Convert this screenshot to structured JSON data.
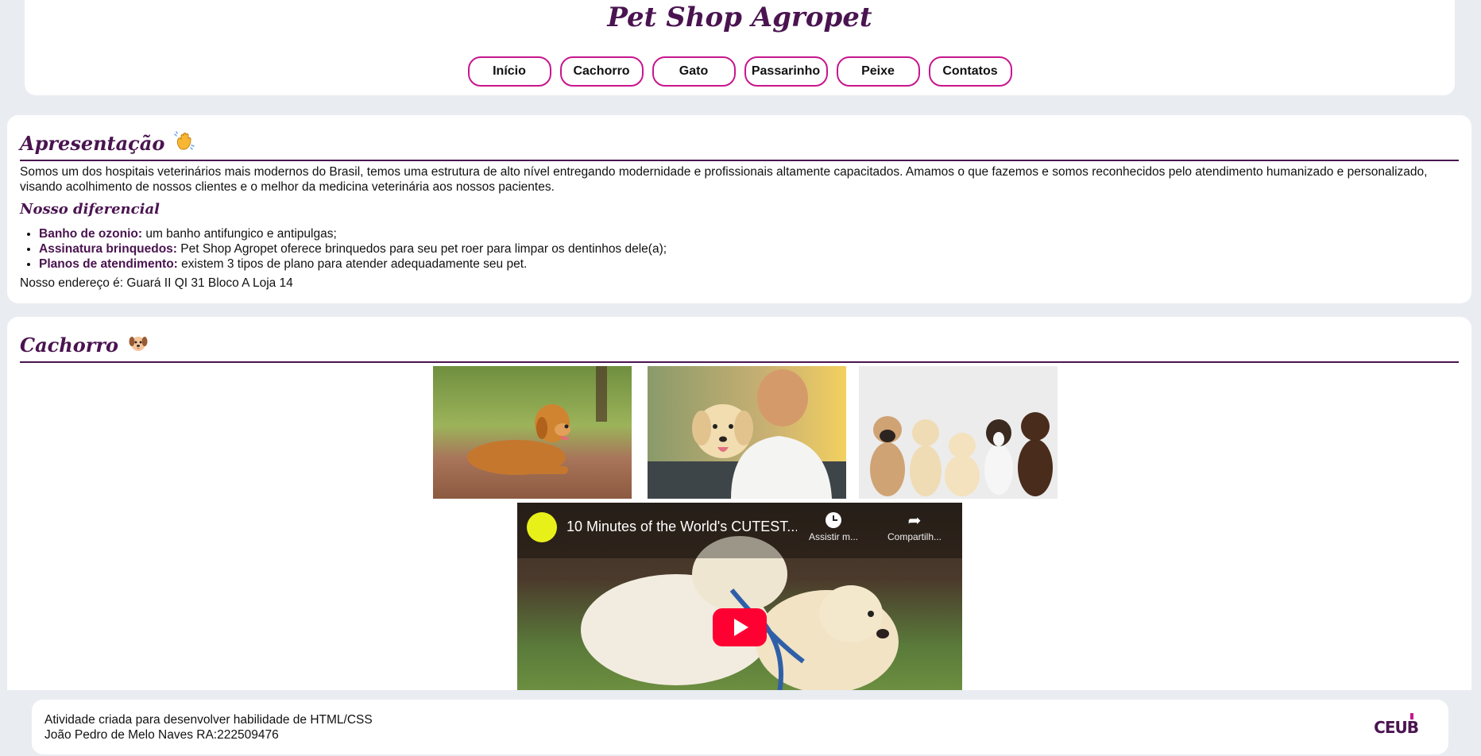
{
  "header": {
    "title": "Pet Shop Agropet",
    "nav": [
      "Início",
      "Cachorro",
      "Gato",
      "Passarinho",
      "Peixe",
      "Contatos"
    ]
  },
  "apresentacao": {
    "title": "Apresentação",
    "emoji": "👋",
    "text": "Somos um dos hospitais veterinários mais modernos do Brasil, temos uma estrutura de alto nível entregando modernidade e profissionais altamente capacitados. Amamos o que fazemos e somos reconhecidos pelo atendimento humanizado e personalizado, visando acolhimento de nossos clientes e o melhor da medicina veterinária aos nossos pacientes.",
    "subtitle": "Nosso diferencial",
    "features": [
      {
        "term": "Banho de ozonio:",
        "desc": " um banho antifungico e antipulgas;"
      },
      {
        "term": "Assinatura brinquedos:",
        "desc": " Pet Shop Agropet oferece brinquedos para seu pet roer para limpar os dentinhos dele(a);"
      },
      {
        "term": "Planos de atendimento:",
        "desc": " existem 3 tipos de plano para atender adequadamente seu pet."
      }
    ],
    "address": "Nosso endereço é: Guará II QI 31 Bloco A Loja 14"
  },
  "cachorro": {
    "title": "Cachorro",
    "emoji": "🐶",
    "video": {
      "title": "10 Minutes of the World's CUTEST...",
      "channel_badge": "",
      "watch_later": "Assistir m...",
      "share": "Compartilh..."
    }
  },
  "footer": {
    "line1": "Atividade criada para desenvolver habilidade de HTML/CSS",
    "line2": "João Pedro de Melo Naves RA:222509476",
    "logo": "CEUB"
  },
  "colors": {
    "accent": "#4a1450",
    "nav_border": "#c8168e",
    "background": "#e9ecf1",
    "youtube_red": "#ff0033"
  }
}
